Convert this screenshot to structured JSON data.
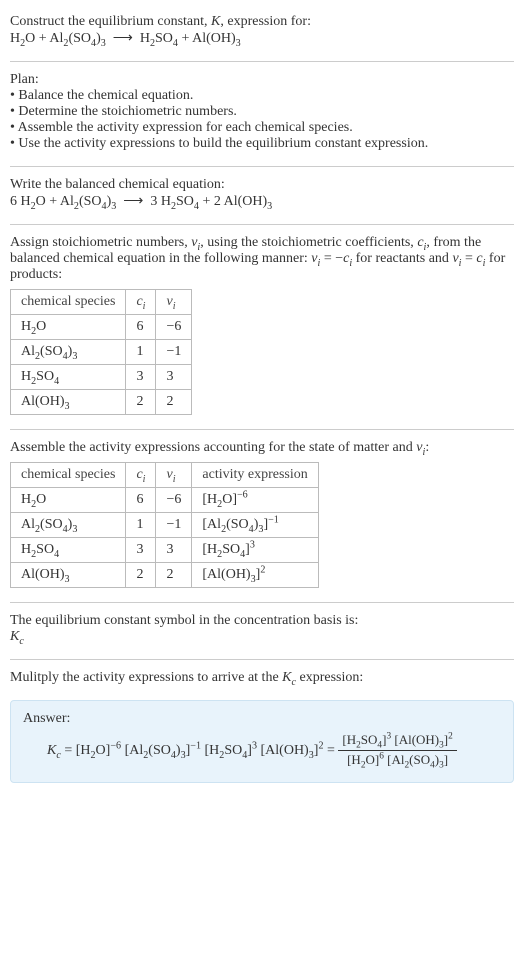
{
  "prompt": {
    "line1_pre": "Construct the equilibrium constant, ",
    "K": "K",
    "line1_post": ", expression for:",
    "eq_unbalanced": "H<sub>2</sub>O + Al<sub>2</sub>(SO<sub>4</sub>)<sub>3</sub> &nbsp;⟶&nbsp; H<sub>2</sub>SO<sub>4</sub> + Al(OH)<sub>3</sub>"
  },
  "plan": {
    "title": "Plan:",
    "items": [
      "Balance the chemical equation.",
      "Determine the stoichiometric numbers.",
      "Assemble the activity expression for each chemical species.",
      "Use the activity expressions to build the equilibrium constant expression."
    ]
  },
  "step_balance": {
    "title": "Write the balanced chemical equation:",
    "eq_balanced": "6 H<sub>2</sub>O + Al<sub>2</sub>(SO<sub>4</sub>)<sub>3</sub> &nbsp;⟶&nbsp; 3 H<sub>2</sub>SO<sub>4</sub> + 2 Al(OH)<sub>3</sub>"
  },
  "step_stoich": {
    "intro": "Assign stoichiometric numbers, <span class='ital'>ν<sub>i</sub></span>, using the stoichiometric coefficients, <span class='ital'>c<sub>i</sub></span>, from the balanced chemical equation in the following manner: <span class='ital'>ν<sub>i</sub></span> = −<span class='ital'>c<sub>i</sub></span> for reactants and <span class='ital'>ν<sub>i</sub></span> = <span class='ital'>c<sub>i</sub></span> for products:",
    "headers": {
      "species": "chemical species",
      "c": "c<sub>i</sub>",
      "v": "ν<sub>i</sub>"
    },
    "rows": [
      {
        "species": "H<sub>2</sub>O",
        "c": "6",
        "v": "−6"
      },
      {
        "species": "Al<sub>2</sub>(SO<sub>4</sub>)<sub>3</sub>",
        "c": "1",
        "v": "−1"
      },
      {
        "species": "H<sub>2</sub>SO<sub>4</sub>",
        "c": "3",
        "v": "3"
      },
      {
        "species": "Al(OH)<sub>3</sub>",
        "c": "2",
        "v": "2"
      }
    ]
  },
  "step_activity": {
    "intro": "Assemble the activity expressions accounting for the state of matter and <span class='ital'>ν<sub>i</sub></span>:",
    "headers": {
      "species": "chemical species",
      "c": "c<sub>i</sub>",
      "v": "ν<sub>i</sub>",
      "act": "activity expression"
    },
    "rows": [
      {
        "species": "H<sub>2</sub>O",
        "c": "6",
        "v": "−6",
        "act": "[H<sub>2</sub>O]<sup>−6</sup>"
      },
      {
        "species": "Al<sub>2</sub>(SO<sub>4</sub>)<sub>3</sub>",
        "c": "1",
        "v": "−1",
        "act": "[Al<sub>2</sub>(SO<sub>4</sub>)<sub>3</sub>]<sup>−1</sup>"
      },
      {
        "species": "H<sub>2</sub>SO<sub>4</sub>",
        "c": "3",
        "v": "3",
        "act": "[H<sub>2</sub>SO<sub>4</sub>]<sup>3</sup>"
      },
      {
        "species": "Al(OH)<sub>3</sub>",
        "c": "2",
        "v": "2",
        "act": "[Al(OH)<sub>3</sub>]<sup>2</sup>"
      }
    ]
  },
  "step_symbol": {
    "line": "The equilibrium constant symbol in the concentration basis is:",
    "symbol": "K<sub>c</sub>"
  },
  "step_multiply": {
    "line": "Mulitply the activity expressions to arrive at the <span class='ital'>K<sub>c</sub></span> expression:"
  },
  "answer": {
    "label": "Answer:",
    "lhs": "<span class='ital'>K<sub>c</sub></span> = [H<sub>2</sub>O]<sup>−6</sup> [Al<sub>2</sub>(SO<sub>4</sub>)<sub>3</sub>]<sup>−1</sup> [H<sub>2</sub>SO<sub>4</sub>]<sup>3</sup> [Al(OH)<sub>3</sub>]<sup>2</sup> = ",
    "frac_num": "[H<sub>2</sub>SO<sub>4</sub>]<sup>3</sup> [Al(OH)<sub>3</sub>]<sup>2</sup>",
    "frac_den": "[H<sub>2</sub>O]<sup>6</sup> [Al<sub>2</sub>(SO<sub>4</sub>)<sub>3</sub>]"
  }
}
